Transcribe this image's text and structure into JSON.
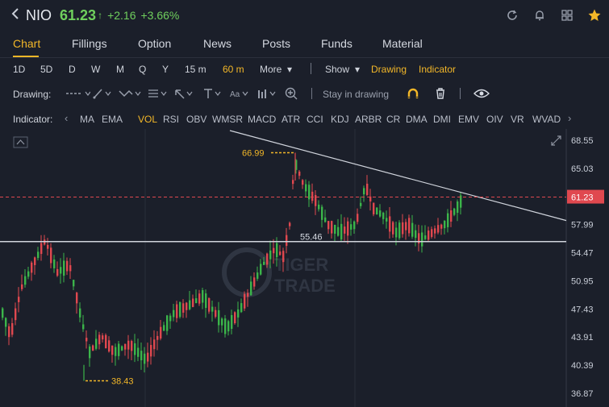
{
  "header": {
    "ticker": "NIO",
    "price": "61.23",
    "change": "+2.16",
    "change_pct": "+3.66%",
    "up_color": "#6fcf5d",
    "icons": [
      "back-icon",
      "refresh-icon",
      "bell-icon",
      "grid-icon",
      "star-icon"
    ]
  },
  "tabs": [
    "Chart",
    "Fillings",
    "Option",
    "News",
    "Posts",
    "Funds",
    "Material"
  ],
  "active_tab": "Chart",
  "periods": {
    "items": [
      "1D",
      "5D",
      "D",
      "W",
      "M",
      "Q",
      "Y",
      "15 m",
      "60 m",
      "More"
    ],
    "active": "60 m",
    "show_label": "Show",
    "drawing_label": "Drawing",
    "indicator_label": "Indicator"
  },
  "drawing_bar": {
    "label": "Drawing:",
    "stay_label": "Stay in drawing",
    "tool_icons": [
      "line-tool-icon",
      "trend-tool-icon",
      "path-tool-icon",
      "fib-tool-icon",
      "arrow-tool-icon",
      "text-tool-icon",
      "font-tool-icon",
      "pattern-tool-icon",
      "zoom-icon",
      "magnet-icon",
      "trash-icon",
      "eye-icon"
    ]
  },
  "indicator_bar": {
    "label": "Indicator:",
    "items": [
      "MA",
      "EMA",
      "VOL",
      "RSI",
      "OBV",
      "WMSR",
      "MACD",
      "ATR",
      "CCI",
      "KDJ",
      "ARBR",
      "CR",
      "DMA",
      "DMI",
      "EMV",
      "OIV",
      "VR",
      "WVAD"
    ],
    "active": "VOL"
  },
  "chart_data": {
    "type": "candlestick",
    "y_ticks": [
      "68.55",
      "65.03",
      "61.23",
      "57.99",
      "54.47",
      "50.95",
      "47.43",
      "43.91",
      "40.39",
      "36.87"
    ],
    "ylim": [
      36.87,
      68.55
    ],
    "current_price": "61.23",
    "annotations": {
      "high": "66.99",
      "low": "38.43",
      "support": "55.46"
    },
    "watermark_line1": "TIGER",
    "watermark_line2": "TRADE",
    "price_label_color": "#e0484f",
    "up_color": "#3bb54a",
    "down_color": "#e0484f",
    "annotation_color": "#f3b728"
  }
}
